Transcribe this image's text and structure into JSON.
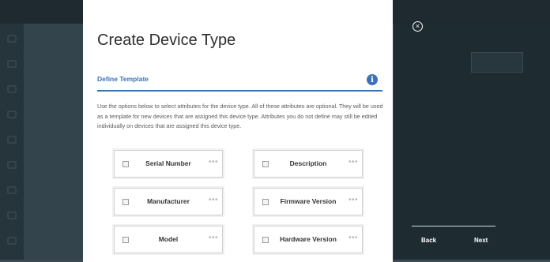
{
  "modal": {
    "title": "Create Device Type",
    "section_title": "Define Template",
    "info_icon": "info-icon",
    "description": "Use the options below to select attributes for the device type. All of these attributes are optional. They will be used as a template for new devices that are assigned this device type. Attributes you do not define may still be edited individually on devices that are assigned this device type.",
    "attributes": [
      {
        "label": "Serial Number",
        "checked": false
      },
      {
        "label": "Description",
        "checked": false
      },
      {
        "label": "Manufacturer",
        "checked": false
      },
      {
        "label": "Firmware Version",
        "checked": false
      },
      {
        "label": "Model",
        "checked": false
      },
      {
        "label": "Hardware Version",
        "checked": false
      }
    ],
    "menu_glyph": "•••"
  },
  "nav": {
    "close_glyph": "×",
    "back_label": "Back",
    "next_label": "Next"
  },
  "colors": {
    "accent": "#3b73b9",
    "overlay_dark": "#1e2b31"
  }
}
